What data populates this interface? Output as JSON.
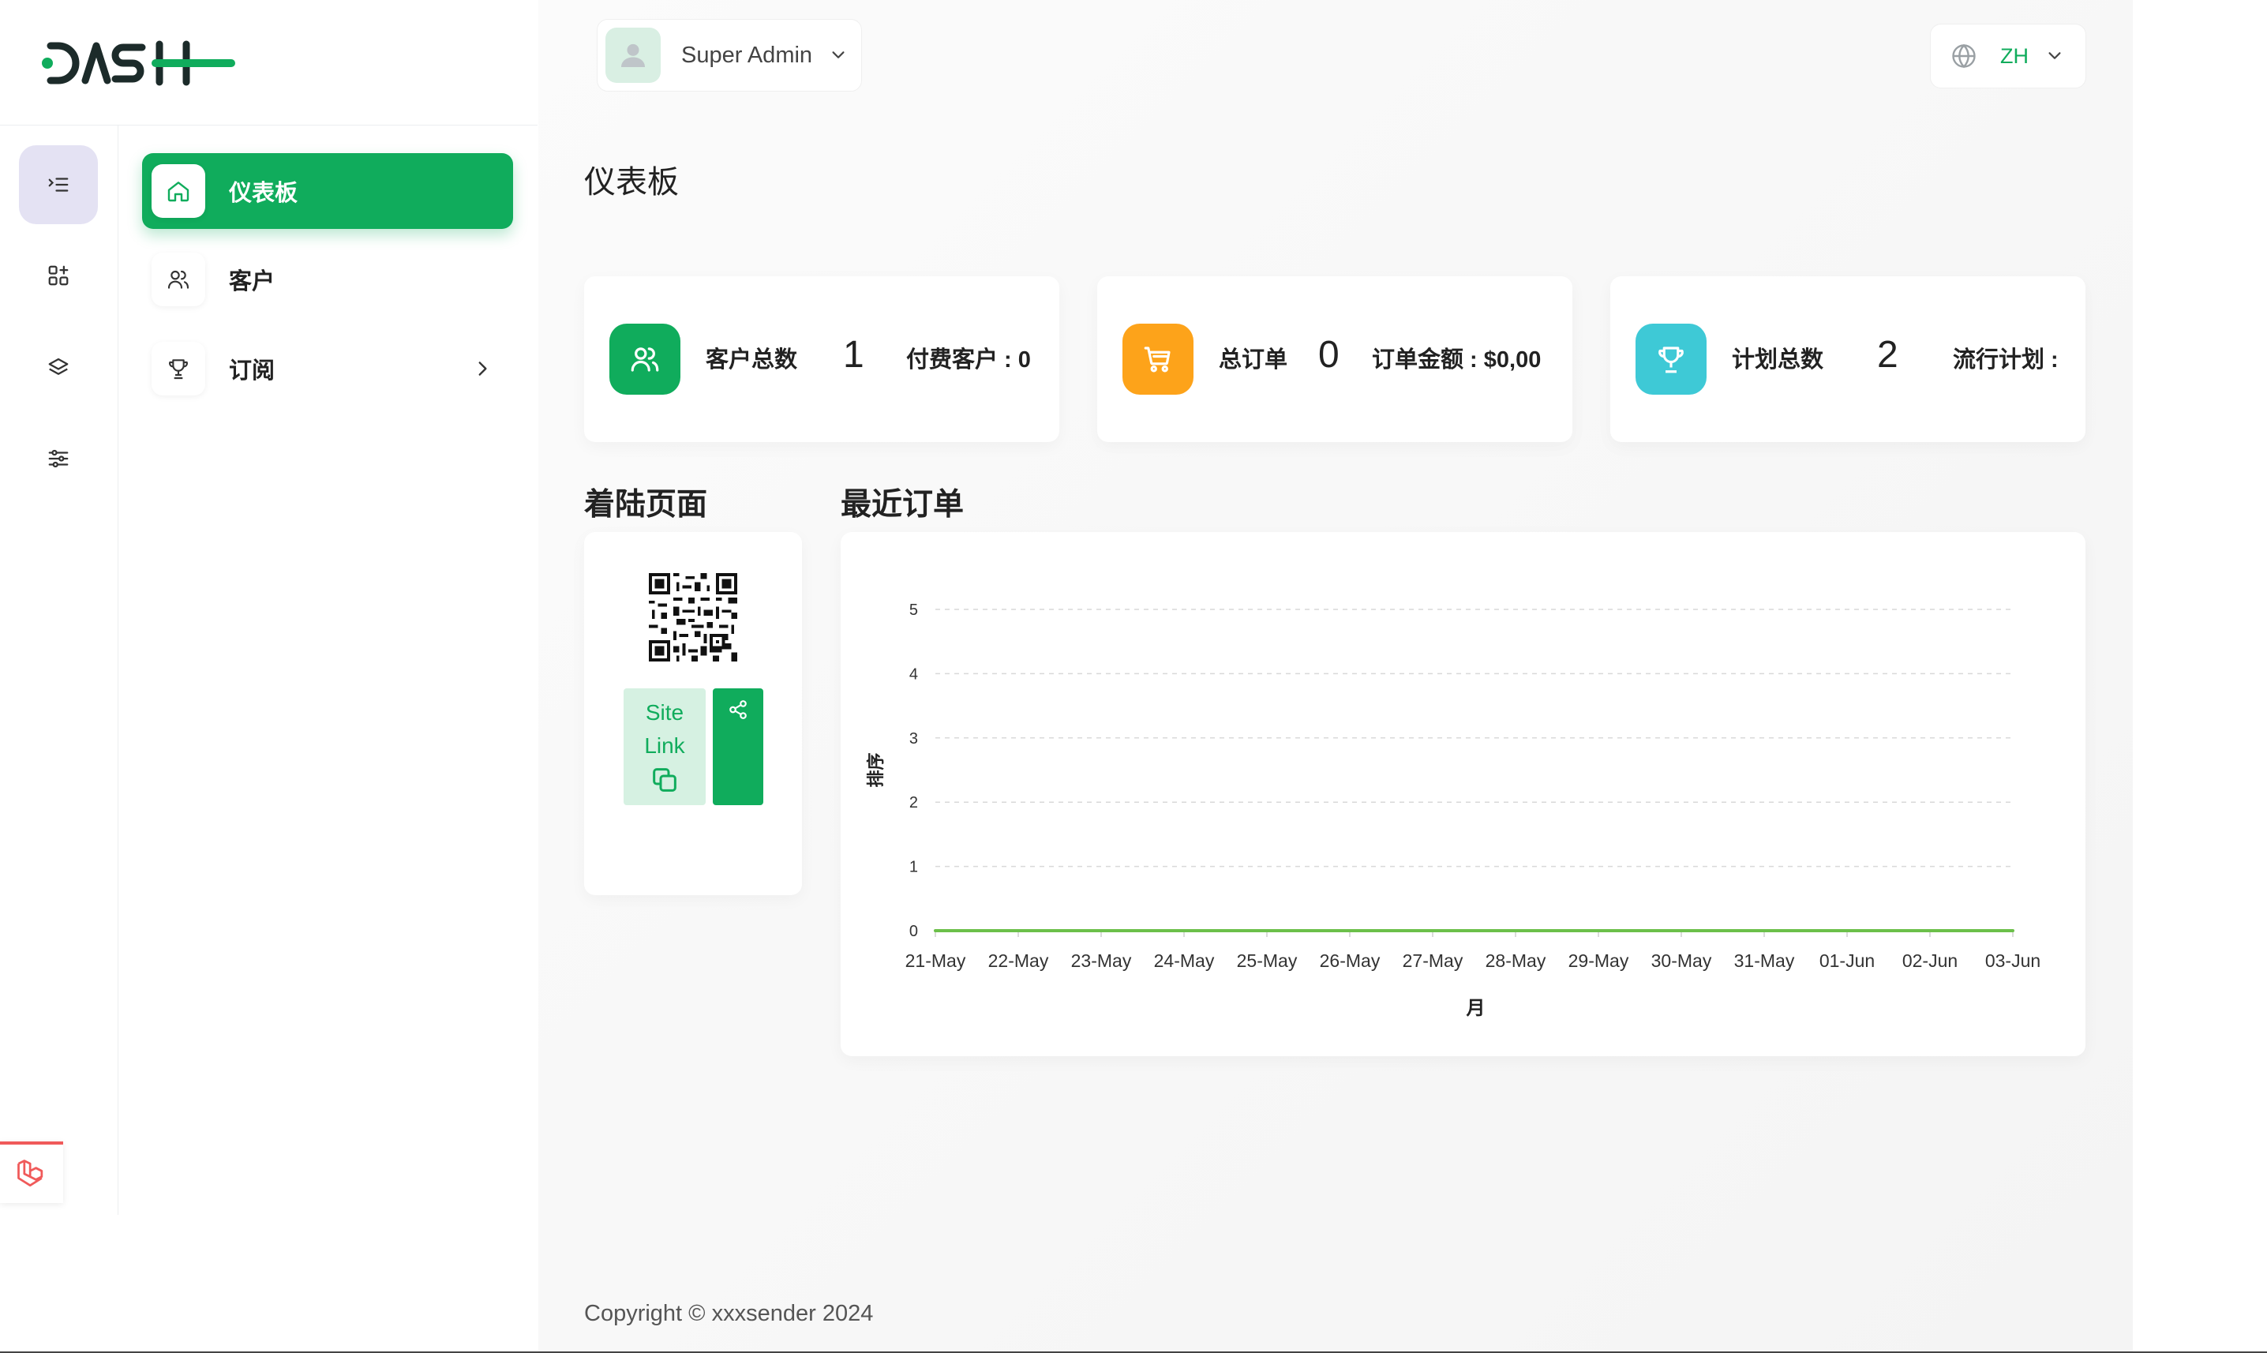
{
  "header": {
    "user_name": "Super Admin",
    "language": "ZH"
  },
  "nav": {
    "items": [
      {
        "label": "仪表板",
        "icon": "home-icon",
        "active": true
      },
      {
        "label": "客户",
        "icon": "users-icon"
      },
      {
        "label": "订阅",
        "icon": "trophy-icon",
        "has_submenu": true
      }
    ]
  },
  "rail": {
    "icons": [
      "menu-toggle-icon",
      "apps-add-icon",
      "layers-icon",
      "sliders-icon",
      "laravel-icon"
    ]
  },
  "page": {
    "title": "仪表板"
  },
  "stats": [
    {
      "label": "客户总数",
      "value": "1",
      "meta": "付费客户 : 0",
      "color": "#10ac5c",
      "icon": "users-icon"
    },
    {
      "label": "总订单",
      "value": "0",
      "meta": "订单金额 : $0,00",
      "color": "#fda31a",
      "icon": "cart-icon"
    },
    {
      "label": "计划总数",
      "value": "2",
      "meta": "流行计划 :",
      "color": "#3ec9d6",
      "icon": "trophy-icon"
    }
  ],
  "landing": {
    "title": "着陆页面",
    "site_link_line1": "Site",
    "site_link_line2": "Link"
  },
  "orders": {
    "title": "最近订单"
  },
  "chart_data": {
    "type": "line",
    "categories": [
      "21-May",
      "22-May",
      "23-May",
      "24-May",
      "25-May",
      "26-May",
      "27-May",
      "28-May",
      "29-May",
      "30-May",
      "31-May",
      "01-Jun",
      "02-Jun",
      "03-Jun"
    ],
    "series": [
      {
        "values": [
          0,
          0,
          0,
          0,
          0,
          0,
          0,
          0,
          0,
          0,
          0,
          0,
          0,
          0
        ],
        "color": "#6cc04a"
      }
    ],
    "xlabel": "月",
    "ylabel": "排序",
    "ylim": [
      0,
      5
    ],
    "yticks": [
      0,
      1,
      2,
      3,
      4,
      5
    ],
    "grid": true
  },
  "footer": {
    "copyright": "Copyright © xxxsender 2024"
  },
  "colors": {
    "primary": "#10ac5c",
    "orange": "#fda31a",
    "cyan": "#3ec9d6",
    "rail_active": "#e4e2f3"
  }
}
